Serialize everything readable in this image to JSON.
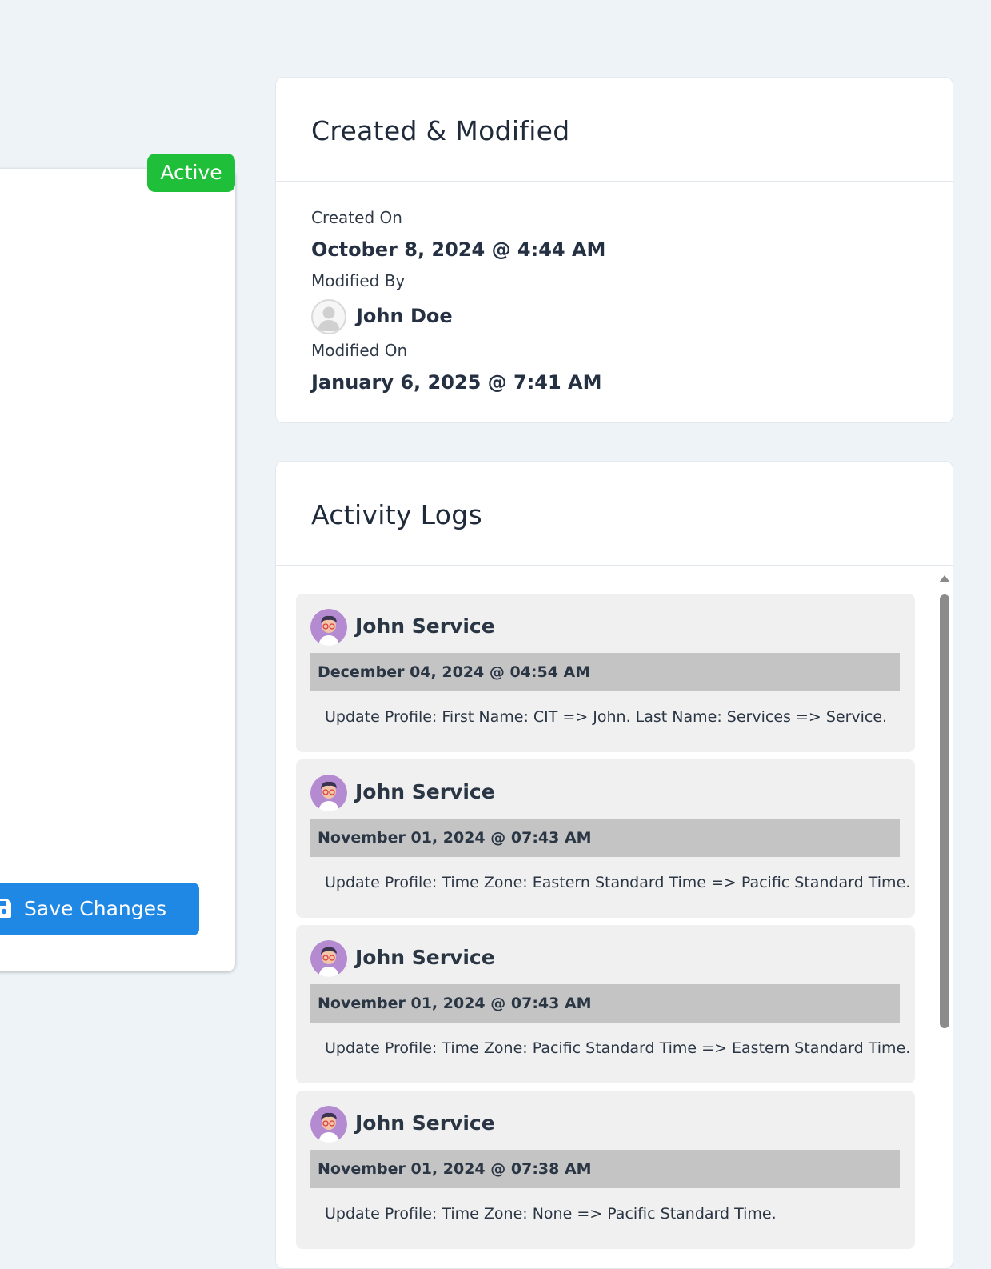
{
  "left_panel": {
    "status_badge": "Active",
    "save_button_label": "Save Changes",
    "save_icon": "floppy-disk-icon"
  },
  "meta_card": {
    "title": "Created & Modified",
    "created_on_label": "Created On",
    "created_on_value": "October 8, 2024 @ 4:44 AM",
    "modified_by_label": "Modified By",
    "modified_by_name": "John Doe",
    "modified_by_avatar": "default-user-avatar-icon",
    "modified_on_label": "Modified On",
    "modified_on_value": "January 6, 2025 @ 7:41 AM"
  },
  "activity_card": {
    "title": "Activity Logs",
    "entries": [
      {
        "user": "John Service",
        "avatar": "cartoon-user-avatar",
        "date": "December 04, 2024 @ 04:54 AM",
        "text": "Update Profile: First Name: CIT => John. Last Name: Services => Service."
      },
      {
        "user": "John Service",
        "avatar": "cartoon-user-avatar",
        "date": "November 01, 2024 @ 07:43 AM",
        "text": "Update Profile: Time Zone: Eastern Standard Time => Pacific Standard Time."
      },
      {
        "user": "John Service",
        "avatar": "cartoon-user-avatar",
        "date": "November 01, 2024 @ 07:43 AM",
        "text": "Update Profile: Time Zone: Pacific Standard Time => Eastern Standard Time."
      },
      {
        "user": "John Service",
        "avatar": "cartoon-user-avatar",
        "date": "November 01, 2024 @ 07:38 AM",
        "text": "Update Profile: Time Zone: None => Pacific Standard Time."
      }
    ]
  },
  "colors": {
    "page_background": "#edf3f7",
    "badge_green": "#1fbf3a",
    "button_blue": "#1f88e5",
    "log_entry_bg": "#f0f0f0",
    "log_date_bar": "#c4c4c4",
    "scrollbar": "#8b8b8b"
  }
}
